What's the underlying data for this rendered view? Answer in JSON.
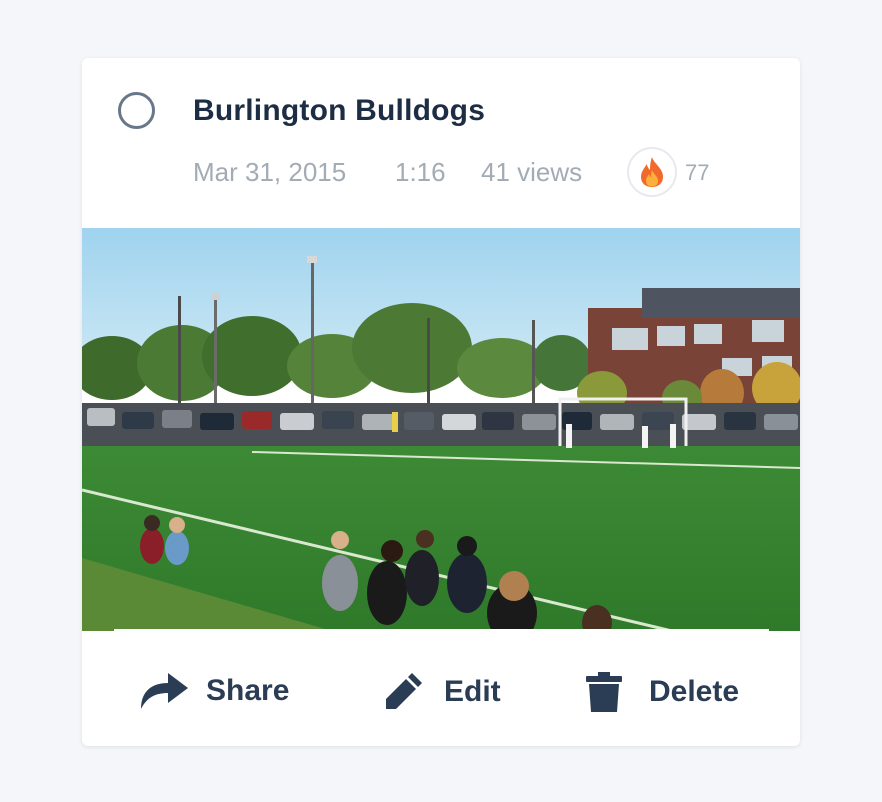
{
  "video": {
    "title": "Burlington Bulldogs",
    "date": "Mar 31, 2015",
    "duration": "1:16",
    "views": "41 views",
    "fire_count": "77"
  },
  "icons": {
    "select": "circle-outline-icon",
    "fire": "fire-icon",
    "share": "share-arrow-icon",
    "edit": "pencil-icon",
    "delete": "trash-icon"
  },
  "actions": {
    "share_label": "Share",
    "edit_label": "Edit",
    "delete_label": "Delete"
  },
  "colors": {
    "title": "#1d2d44",
    "meta": "#a3abb5",
    "action": "#2b3d54",
    "fire_outer": "#f26a2b",
    "fire_inner": "#fbb03b"
  }
}
